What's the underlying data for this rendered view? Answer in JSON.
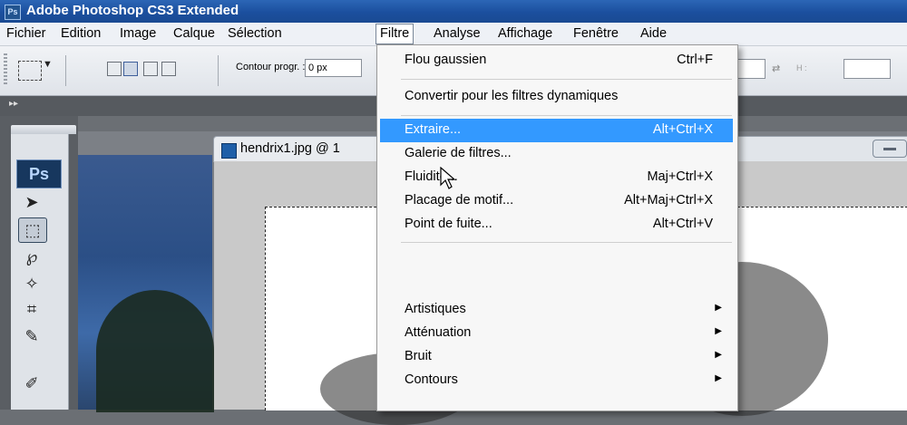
{
  "window": {
    "title": "Adobe Photoshop CS3 Extended",
    "logo": "Ps"
  },
  "menubar": [
    "Fichier",
    "Edition",
    "Image",
    "Calque",
    "Sélection",
    "Filtre",
    "Analyse",
    "Affichage",
    "Fenêtre",
    "Aide"
  ],
  "options": {
    "contour_label": "Contour progr. :",
    "contour_value": "0 px",
    "h_label": "H :"
  },
  "toolbox": {
    "logo": "Ps"
  },
  "document": {
    "title": "hendrix1.jpg @ 1"
  },
  "filter_menu": [
    {
      "label": "Flou gaussien",
      "shortcut": "Ctrl+F"
    },
    {
      "label": "Convertir pour les filtres dynamiques",
      "shortcut": ""
    },
    {
      "label": "Extraire...",
      "shortcut": "Alt+Ctrl+X",
      "highlighted": true
    },
    {
      "label": "Galerie de filtres...",
      "shortcut": ""
    },
    {
      "label": "Fluidité...",
      "shortcut": "Maj+Ctrl+X"
    },
    {
      "label": "Placage de motif...",
      "shortcut": "Alt+Maj+Ctrl+X"
    },
    {
      "label": "Point de fuite...",
      "shortcut": "Alt+Ctrl+V"
    },
    {
      "label": "Artistiques",
      "submenu": true
    },
    {
      "label": "Atténuation",
      "submenu": true
    },
    {
      "label": "Bruit",
      "submenu": true
    },
    {
      "label": "Contours",
      "submenu": true
    }
  ],
  "colors": {
    "highlight": "#3399ff",
    "titlebar": "#1b4f9e"
  }
}
